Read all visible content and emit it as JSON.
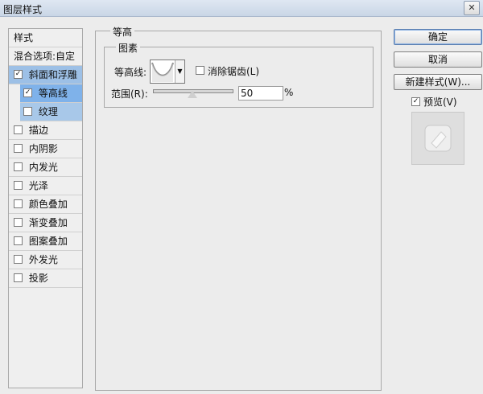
{
  "window": {
    "title": "图层样式",
    "close_label": "✕"
  },
  "sidebar": {
    "header": "样式",
    "blend": "混合选项:自定",
    "bevel": {
      "label": "斜面和浮雕",
      "checked": true
    },
    "contour": {
      "label": "等高线",
      "checked": true
    },
    "texture": {
      "label": "纹理",
      "checked": false
    },
    "items": [
      {
        "label": "描边",
        "checked": false
      },
      {
        "label": "内阴影",
        "checked": false
      },
      {
        "label": "内发光",
        "checked": false
      },
      {
        "label": "光泽",
        "checked": false
      },
      {
        "label": "颜色叠加",
        "checked": false
      },
      {
        "label": "渐变叠加",
        "checked": false
      },
      {
        "label": "图案叠加",
        "checked": false
      },
      {
        "label": "外发光",
        "checked": false
      },
      {
        "label": "投影",
        "checked": false
      }
    ]
  },
  "panel": {
    "group_label": "等高",
    "sub_group_label": "图素",
    "contour_label": "等高线:",
    "anti_alias_label": "消除锯齿(L)",
    "anti_alias_checked": false,
    "range_label": "范围(R):",
    "range_value": "50",
    "range_unit": "%",
    "range_percent": 50
  },
  "buttons": {
    "ok": "确定",
    "cancel": "取消",
    "new_style": "新建样式(W)...",
    "preview_label": "预览(V)",
    "preview_checked": true
  }
}
